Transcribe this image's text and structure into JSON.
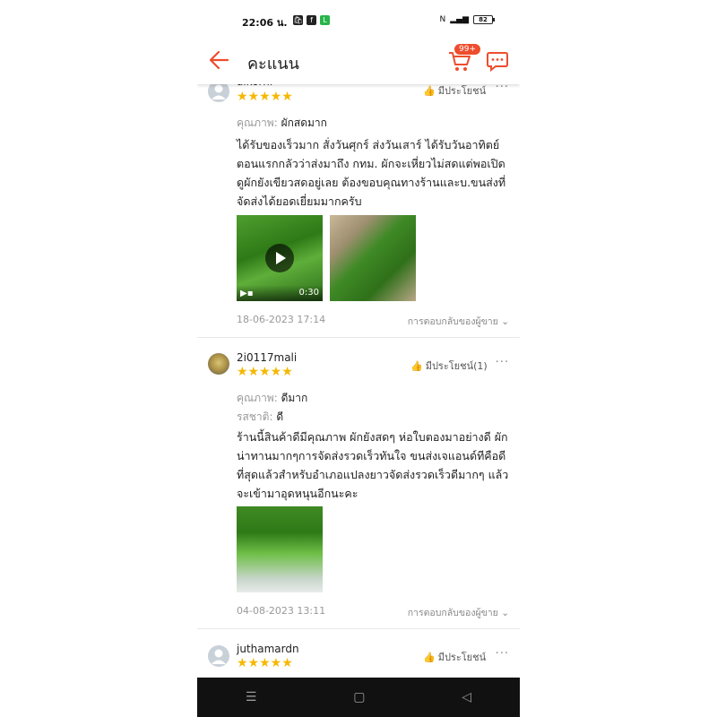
{
  "status_bar": {
    "time": "22:06 น.",
    "battery": "82"
  },
  "header": {
    "title": "คะแนน",
    "cart_badge": "99+"
  },
  "reviews": [
    {
      "username": "aikornr",
      "stars": "★★★★★",
      "helpful": "มีประโยชน์",
      "attributes": [
        {
          "key": "คุณภาพ: ",
          "value": "ผักสดมาก"
        }
      ],
      "text": "ได้รับของเร็วมาก สั่งวันศุกร์ ส่งวันเสาร์ ได้รับวันอาทิตย์ ตอนแรกกลัวว่าส่งมาถึง กทม. ผักจะเหี่ยวไม่สดแต่พอเปิดดูผักยังเขียวสดอยู่เลย ต้องขอบคุณทางร้านและบ.ขนส่งที่จัดส่งได้ยอดเยี่ยมมากครับ",
      "video_duration": "0:30",
      "date": "18-06-2023 17:14",
      "seller_reply": "การตอบกลับของผู้ขาย"
    },
    {
      "username": "2i0117mali",
      "stars": "★★★★★",
      "helpful": "มีประโยชน์(1)",
      "attributes": [
        {
          "key": "คุณภาพ: ",
          "value": "ดีมาก"
        },
        {
          "key": "รสชาติ: ",
          "value": "ดี"
        }
      ],
      "text": "ร้านนี้สินค้าดีมีคุณภาพ ผักยังสดๆ ห่อใบตองมาอย่างดี ผักน่าทานมากๆการจัดส่งรวดเร็วทันใจ ขนส่งเจแอนด์ทีคือดีที่สุดแล้วสำหรับอำเภอแปลงยาวจัดส่งรวดเร็วดีมากๆ แล้วจะเข้ามาอุดหนุนอีกนะคะ",
      "date": "04-08-2023 13:11",
      "seller_reply": "การตอบกลับของผู้ขาย"
    },
    {
      "username": "juthamardn",
      "stars": "★★★★★",
      "helpful": "มีประโยชน์"
    }
  ],
  "nav": {
    "menu": "☰",
    "home": "▢",
    "back": "◁"
  },
  "colors": {
    "accent": "#ee4d2d",
    "star": "#f5b800"
  }
}
